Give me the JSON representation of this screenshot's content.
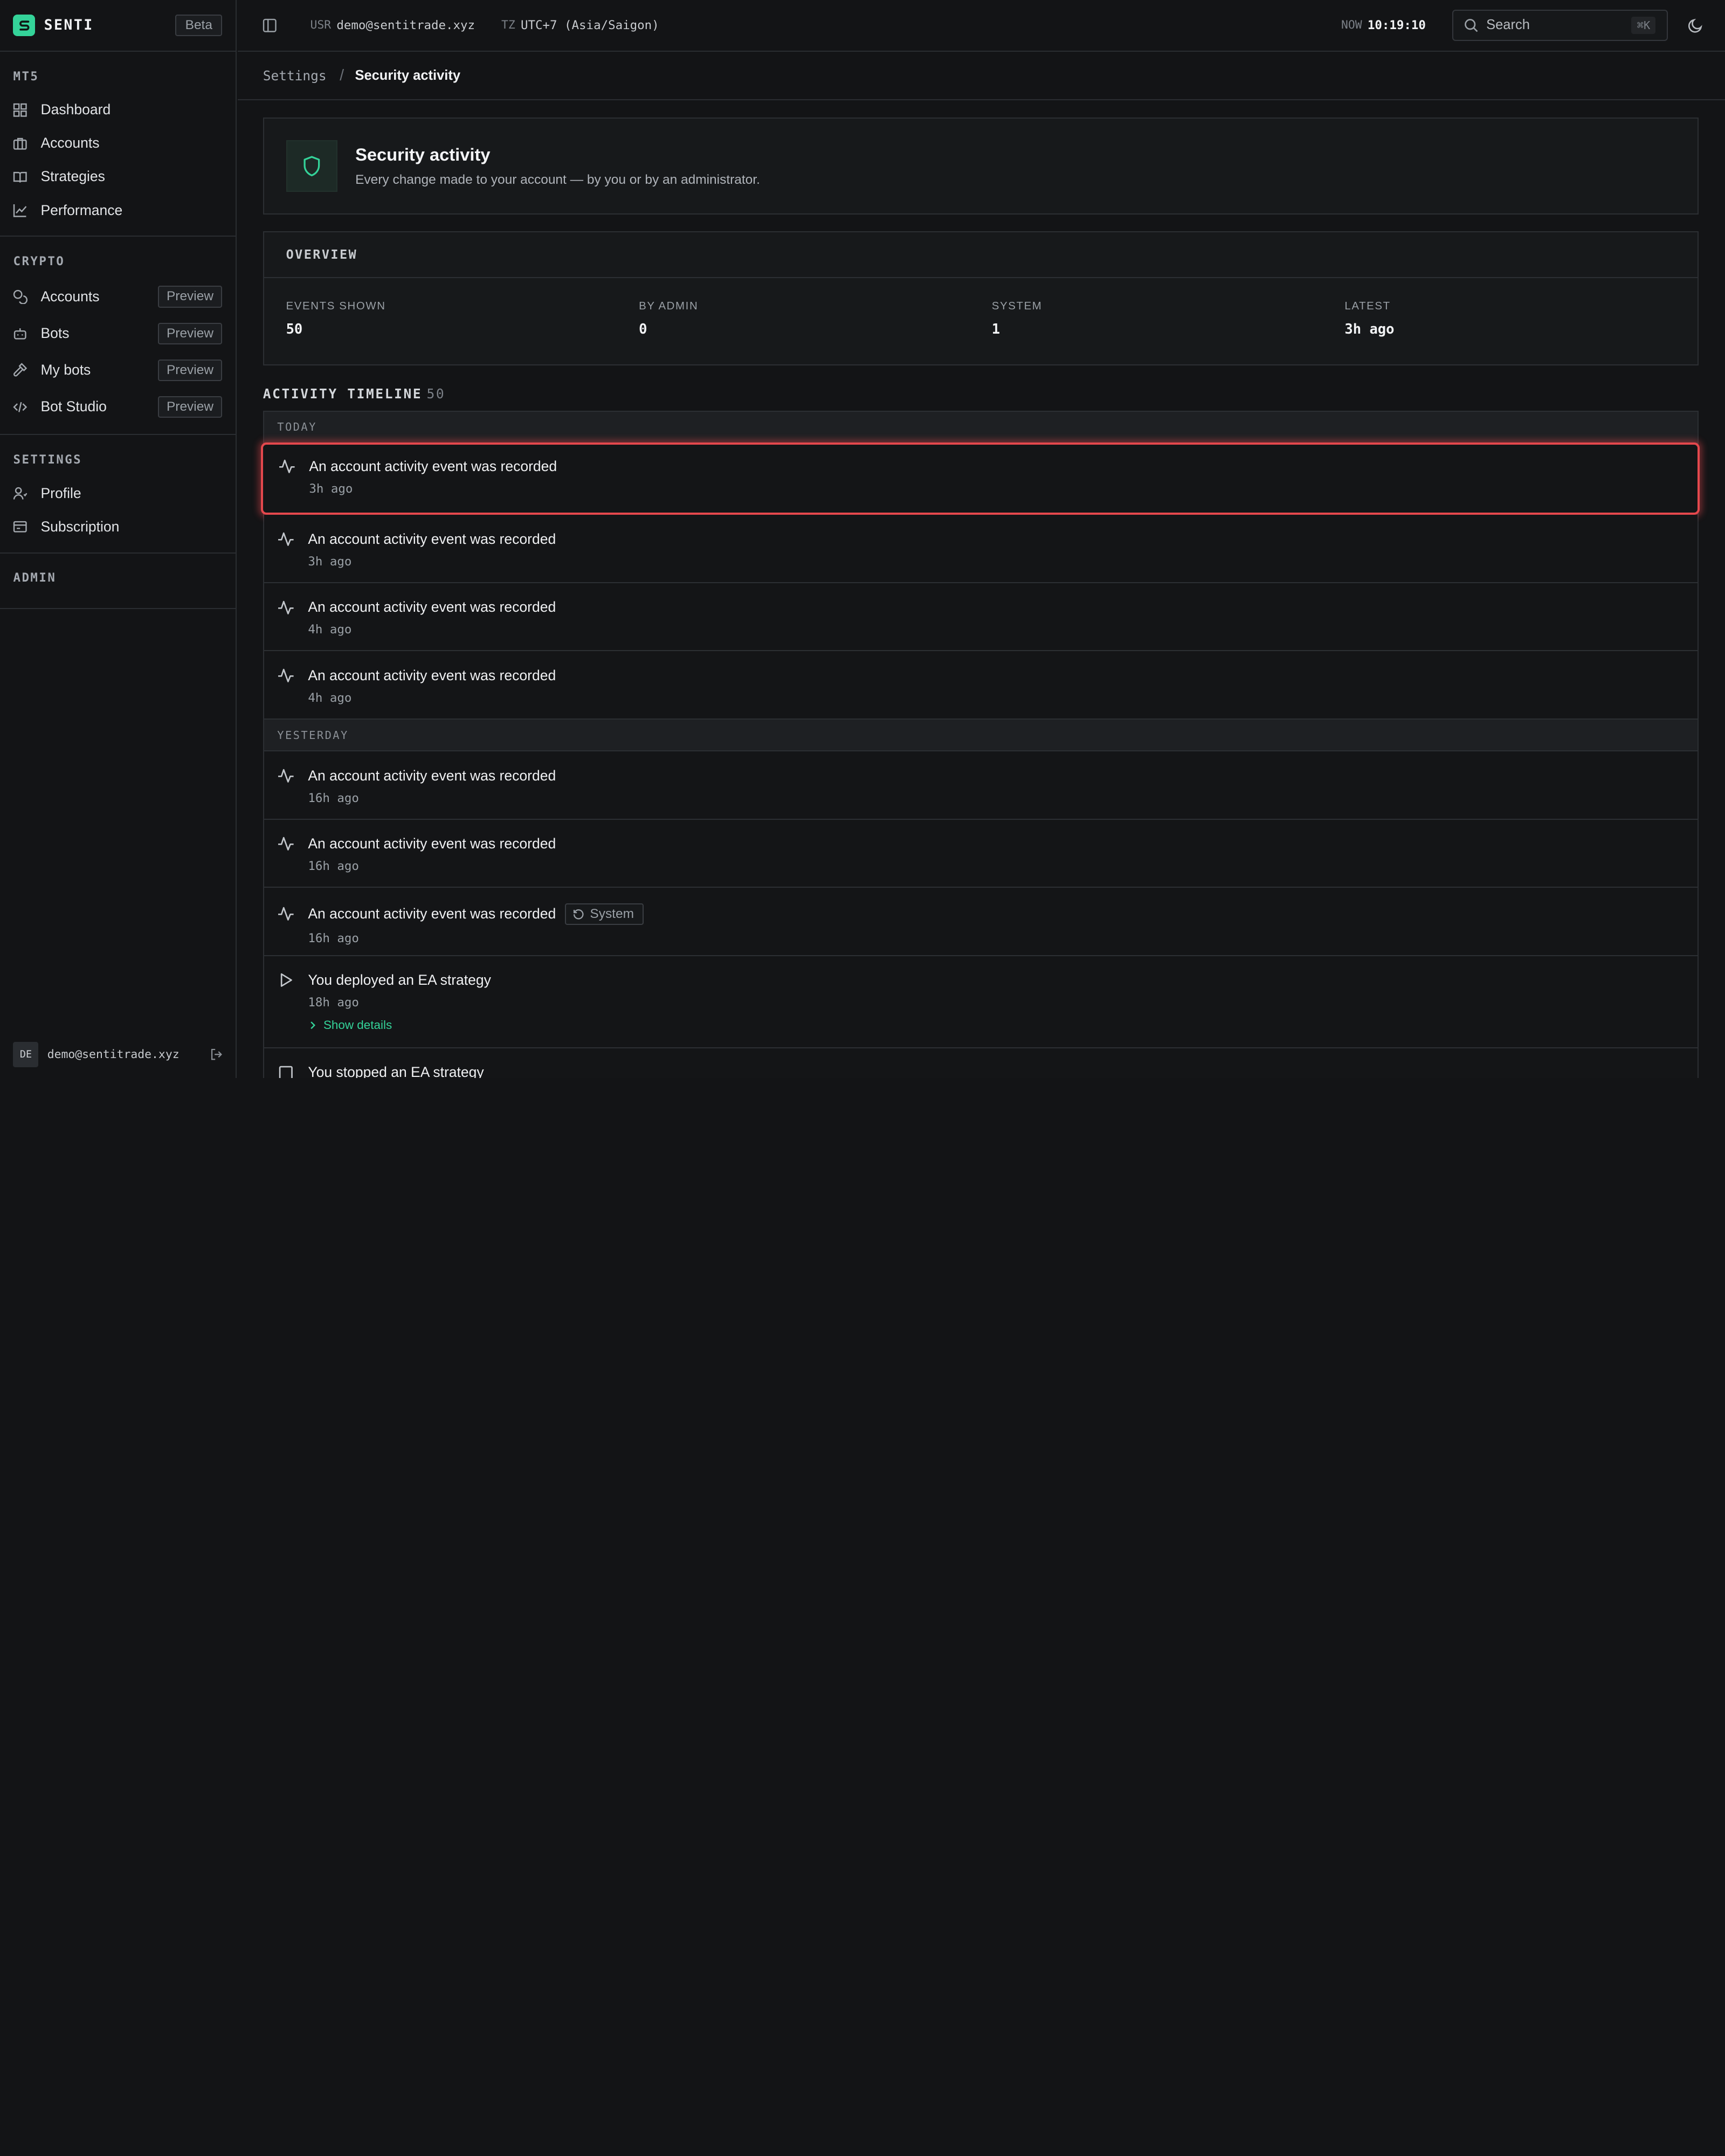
{
  "brand": {
    "name": "SENTI",
    "badge": "Beta"
  },
  "sidebar": {
    "sections": [
      {
        "heading": "MT5",
        "items": [
          {
            "label": "Dashboard",
            "icon": "grid-icon"
          },
          {
            "label": "Accounts",
            "icon": "briefcase-icon"
          },
          {
            "label": "Strategies",
            "icon": "book-icon"
          },
          {
            "label": "Performance",
            "icon": "chart-line-icon"
          }
        ]
      },
      {
        "heading": "CRYPTO",
        "items": [
          {
            "label": "Accounts",
            "icon": "coins-icon",
            "badge": "Preview"
          },
          {
            "label": "Bots",
            "icon": "bot-icon",
            "badge": "Preview"
          },
          {
            "label": "My bots",
            "icon": "hammer-icon",
            "badge": "Preview"
          },
          {
            "label": "Bot Studio",
            "icon": "code-icon",
            "badge": "Preview"
          }
        ]
      },
      {
        "heading": "SETTINGS",
        "items": [
          {
            "label": "Profile",
            "icon": "user-icon"
          },
          {
            "label": "Subscription",
            "icon": "card-icon"
          }
        ]
      },
      {
        "heading": "ADMIN",
        "items": []
      }
    ],
    "user": {
      "initials": "DE",
      "email": "demo@sentitrade.xyz"
    }
  },
  "topbar": {
    "usr_label": "USR",
    "usr_value": "demo@sentitrade.xyz",
    "tz_label": "TZ",
    "tz_value": "UTC+7 (Asia/Saigon)",
    "now_label": "NOW",
    "now_value": "10:19:10",
    "search_placeholder": "Search",
    "search_shortcut": "⌘K"
  },
  "breadcrumb": {
    "root": "Settings",
    "separator": "/",
    "current": "Security activity"
  },
  "header": {
    "title": "Security activity",
    "subtitle": "Every change made to your account — by you or by an administrator."
  },
  "overview": {
    "heading": "OVERVIEW",
    "stats": [
      {
        "label": "EVENTS SHOWN",
        "value": "50"
      },
      {
        "label": "BY ADMIN",
        "value": "0"
      },
      {
        "label": "SYSTEM",
        "value": "1"
      },
      {
        "label": "LATEST",
        "value": "3h ago"
      }
    ]
  },
  "timeline": {
    "title": "ACTIVITY TIMELINE",
    "count": "50",
    "groups": [
      {
        "label": "TODAY",
        "events": [
          {
            "title": "An account activity event was recorded",
            "time": "3h ago"
          },
          {
            "title": "An account activity event was recorded",
            "time": "3h ago"
          },
          {
            "title": "An account activity event was recorded",
            "time": "4h ago"
          },
          {
            "title": "An account activity event was recorded",
            "time": "4h ago"
          }
        ]
      },
      {
        "label": "YESTERDAY",
        "events": [
          {
            "title": "An account activity event was recorded",
            "time": "16h ago"
          },
          {
            "title": "An account activity event was recorded",
            "time": "16h ago"
          },
          {
            "title": "An account activity event was recorded",
            "time": "16h ago",
            "badge": "System"
          },
          {
            "title": "You deployed an EA strategy",
            "time": "18h ago",
            "details": "Show details"
          },
          {
            "title": "You stopped an EA strategy"
          }
        ]
      }
    ]
  },
  "colors": {
    "accent": "#34d399",
    "highlight": "#e5484d",
    "background": "#131416"
  }
}
